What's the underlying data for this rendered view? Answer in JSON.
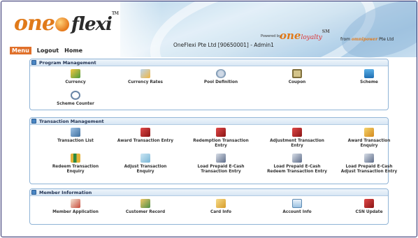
{
  "header": {
    "logo_main": "one",
    "logo_flexi": "flexi",
    "logo_tm": "TM",
    "company": "OneFlexi Pte Ltd [90650001] - Admin1",
    "powered_by": "Powered by",
    "loyalty_main": "one",
    "loyalty_sub": "loyalty",
    "loyalty_tm": "SM",
    "from_label": "from",
    "from_brand": "omnipower",
    "from_suffix": "Pte Ltd"
  },
  "nav": {
    "menu": "Menu",
    "logout": "Logout",
    "home": "Home"
  },
  "panels": {
    "program": {
      "title": "Program Management",
      "items": [
        {
          "label": "Currency",
          "icon": "currency-icon"
        },
        {
          "label": "Currency Rates",
          "icon": "currency-rates-icon"
        },
        {
          "label": "Pool Definition",
          "icon": "pool-definition-icon"
        },
        {
          "label": "Coupon",
          "icon": "coupon-icon"
        },
        {
          "label": "Scheme",
          "icon": "scheme-icon"
        },
        {
          "label": "Scheme Counter",
          "icon": "scheme-counter-icon"
        }
      ]
    },
    "transaction": {
      "title": "Transaction Management",
      "items": [
        {
          "label": "Transaction List",
          "icon": "transaction-list-icon"
        },
        {
          "label": "Award Transaction Entry",
          "icon": "award-entry-icon"
        },
        {
          "label": "Redemption Transaction Entry",
          "icon": "redemption-entry-icon"
        },
        {
          "label": "Adjustment Transaction Entry",
          "icon": "adjustment-entry-icon"
        },
        {
          "label": "Award Transaction Enquiry",
          "icon": "award-enquiry-icon"
        },
        {
          "label": "Redeem Transaction Enquiry",
          "icon": "redeem-enquiry-icon"
        },
        {
          "label": "Adjust Transaction Enquiry",
          "icon": "adjust-enquiry-icon"
        },
        {
          "label": "Load Prepaid E-Cash Transaction Entry",
          "icon": "load-ecash-entry-icon"
        },
        {
          "label": "Load Prepaid E-Cash Redeem Transaction Entry",
          "icon": "load-ecash-redeem-icon"
        },
        {
          "label": "Load Prepaid E-Cash Adjust Transaction Entry",
          "icon": "load-ecash-adjust-icon"
        }
      ]
    },
    "member": {
      "title": "Member Information",
      "items": [
        {
          "label": "Member Application",
          "icon": "member-application-icon"
        },
        {
          "label": "Customer Record",
          "icon": "customer-record-icon"
        },
        {
          "label": "Card Info",
          "icon": "card-info-icon"
        },
        {
          "label": "Account Info",
          "icon": "account-info-icon"
        },
        {
          "label": "CSN Update",
          "icon": "csn-update-icon"
        }
      ]
    }
  }
}
